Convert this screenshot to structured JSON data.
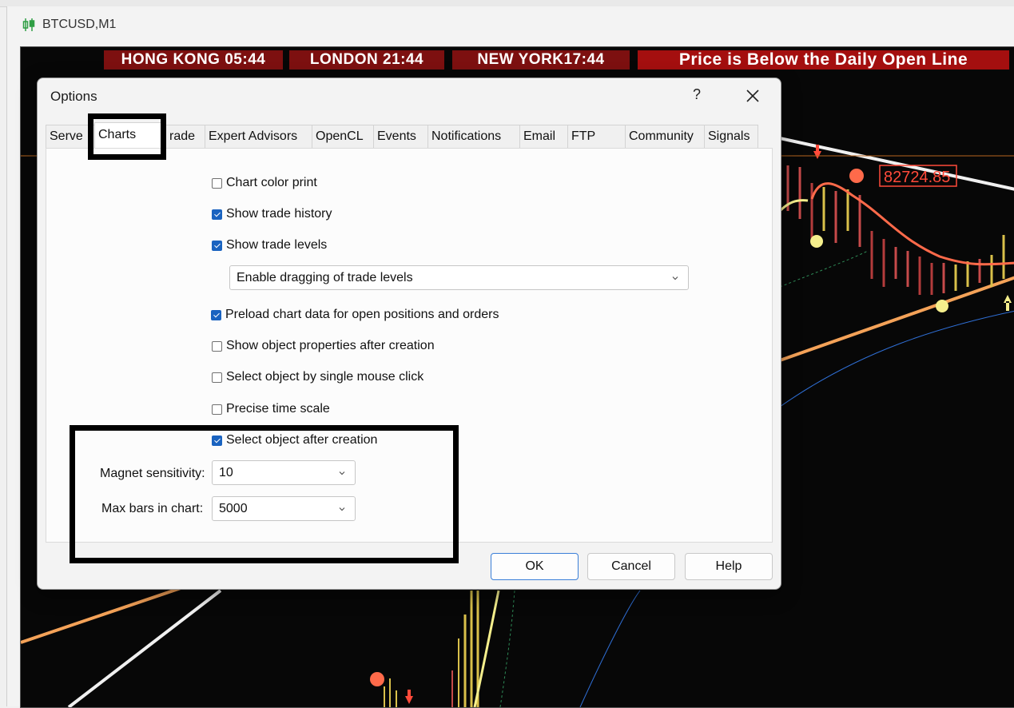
{
  "chart_window": {
    "title": "BTCUSD,M1",
    "icon": "candlestick-chart-icon"
  },
  "banners": [
    {
      "label": "HONG KONG 05:44"
    },
    {
      "label": "LONDON  21:44"
    },
    {
      "label": "NEW YORK17:44"
    },
    {
      "label": "Price is Below the Daily Open Line"
    }
  ],
  "price_label": "82724.85",
  "dialog": {
    "title": "Options",
    "help_label": "?",
    "tabs": [
      {
        "label": "Serve"
      },
      {
        "label": "Charts"
      },
      {
        "label": "rade"
      },
      {
        "label": "Expert Advisors"
      },
      {
        "label": "OpenCL"
      },
      {
        "label": "Events"
      },
      {
        "label": "Notifications"
      },
      {
        "label": "Email"
      },
      {
        "label": "FTP"
      },
      {
        "label": "Community"
      },
      {
        "label": "Signals"
      }
    ],
    "active_tab": "Charts",
    "options": [
      {
        "label": "Chart color print",
        "checked": false
      },
      {
        "label": "Show trade history",
        "checked": true
      },
      {
        "label": "Show trade levels",
        "checked": true
      },
      {
        "label": "Preload chart data for open positions and orders",
        "checked": true
      },
      {
        "label": "Show object properties after creation",
        "checked": false
      },
      {
        "label": "Select object by single mouse click",
        "checked": false
      },
      {
        "label": "Precise time scale",
        "checked": false
      },
      {
        "label": "Select object after creation",
        "checked": true
      }
    ],
    "trade_levels_select": "Enable dragging of trade levels",
    "magnet_label": "Magnet sensitivity:",
    "magnet_value": "10",
    "maxbars_label": "Max bars in chart:",
    "maxbars_value": "5000",
    "buttons": {
      "ok": "OK",
      "cancel": "Cancel",
      "help": "Help"
    }
  },
  "colors": {
    "banner": "#7d1010",
    "banner_alert": "#a40f0f",
    "chart_bg": "#070707",
    "accent_blue": "#1a63c0",
    "price_line": "#ff6a4a",
    "trend_orange": "#f4a258"
  }
}
